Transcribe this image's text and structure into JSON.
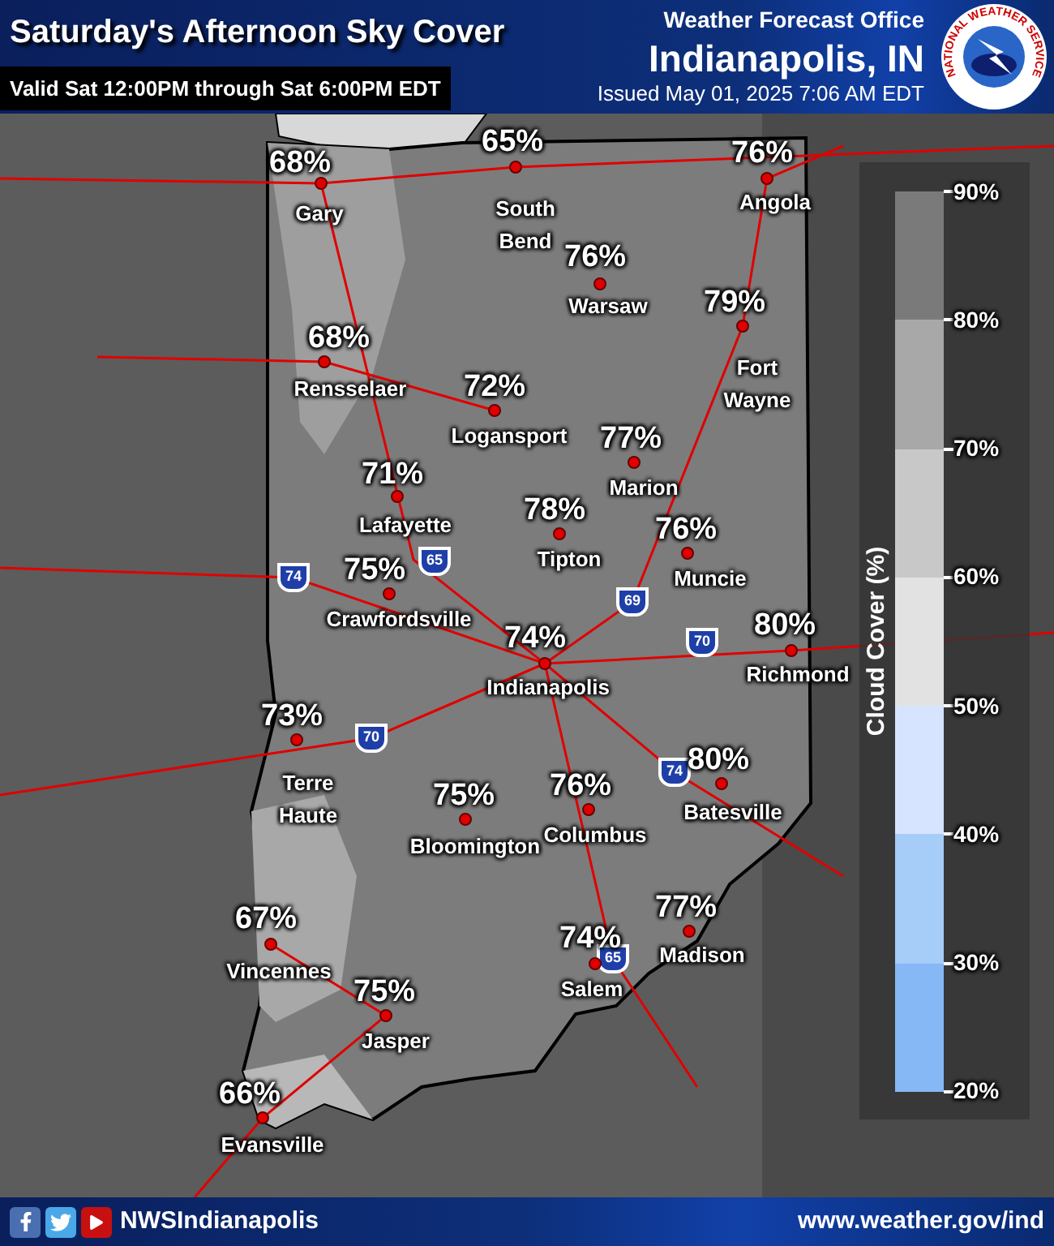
{
  "header": {
    "title": "Saturday's Afternoon Sky Cover",
    "valid_period": "Valid Sat 12:00PM through Sat 6:00PM EDT",
    "office_label": "Weather Forecast Office",
    "office_name": "Indianapolis, IN",
    "issued": "Issued May 01, 2025 7:06 AM EDT",
    "logo_text": "NATIONAL WEATHER SERVICE"
  },
  "map": {
    "cities": [
      {
        "name": "Gary",
        "value": "68%"
      },
      {
        "name": "South Bend",
        "value": "65%"
      },
      {
        "name": "Angola",
        "value": "76%"
      },
      {
        "name": "Warsaw",
        "value": "76%"
      },
      {
        "name": "Rensselaer",
        "value": "68%"
      },
      {
        "name": "Fort Wayne",
        "value": "79%"
      },
      {
        "name": "Logansport",
        "value": "72%"
      },
      {
        "name": "Marion",
        "value": "77%"
      },
      {
        "name": "Lafayette",
        "value": "71%"
      },
      {
        "name": "Tipton",
        "value": "78%"
      },
      {
        "name": "Muncie",
        "value": "76%"
      },
      {
        "name": "Crawfordsville",
        "value": "75%"
      },
      {
        "name": "Indianapolis",
        "value": "74%"
      },
      {
        "name": "Richmond",
        "value": "80%"
      },
      {
        "name": "Terre Haute",
        "value": "73%"
      },
      {
        "name": "Bloomington",
        "value": "75%"
      },
      {
        "name": "Columbus",
        "value": "76%"
      },
      {
        "name": "Batesville",
        "value": "80%"
      },
      {
        "name": "Vincennes",
        "value": "67%"
      },
      {
        "name": "Salem",
        "value": "74%"
      },
      {
        "name": "Madison",
        "value": "77%"
      },
      {
        "name": "Jasper",
        "value": "75%"
      },
      {
        "name": "Evansville",
        "value": "66%"
      }
    ],
    "highway_shields": [
      {
        "label": "74"
      },
      {
        "label": "65"
      },
      {
        "label": "69"
      },
      {
        "label": "70"
      },
      {
        "label": "70"
      },
      {
        "label": "74"
      },
      {
        "label": "65"
      }
    ]
  },
  "legend": {
    "title": "Cloud Cover (%)",
    "ticks": [
      "90%",
      "80%",
      "70%",
      "60%",
      "50%",
      "40%",
      "30%",
      "20%"
    ],
    "bands": [
      {
        "color": "#7a7a7a"
      },
      {
        "color": "#a8a8a8"
      },
      {
        "color": "#c8c8c8"
      },
      {
        "color": "#e2e2e2"
      },
      {
        "color": "#d6e4ff"
      },
      {
        "color": "#a6ccf8"
      },
      {
        "color": "#86b8f5"
      }
    ]
  },
  "footer": {
    "handle": "NWSIndianapolis",
    "url": "www.weather.gov/ind"
  }
}
